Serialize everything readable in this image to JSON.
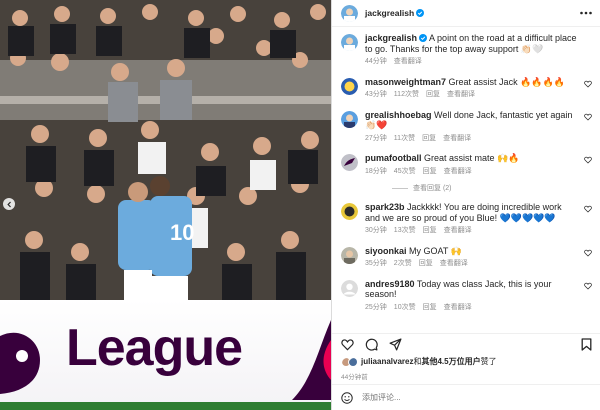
{
  "header": {
    "username": "jackgrealish"
  },
  "caption": {
    "username": "jackgrealish",
    "text": "A point on the road at a difficult place to go. Thanks for the top away support 👏🏻🤍",
    "time": "44分钟",
    "translate": "查看翻译"
  },
  "comments": [
    {
      "username": "masonweightman7",
      "text": "Great assist Jack 🔥🔥🔥🔥",
      "time": "43分钟",
      "likes": "112次赞",
      "reply": "回复",
      "translate": "查看翻译",
      "avatar_color": "#2a5db0"
    },
    {
      "username": "grealishhoebag",
      "text": "Well done Jack, fantastic yet again 👏🏻❤️",
      "time": "27分钟",
      "likes": "11次赞",
      "reply": "回复",
      "translate": "查看翻译",
      "avatar_color": "#5a9fe0"
    },
    {
      "username": "pumafootball",
      "text": "Great assist mate 🙌🔥",
      "time": "18分钟",
      "likes": "45次赞",
      "reply": "回复",
      "translate": "查看翻译",
      "avatar_color": "#c0c0c8",
      "view_replies": "查看回复 (2)"
    },
    {
      "username": "spark23b",
      "text": "Jackkkk! You are doing incredible work and we are so proud of you Blue! 💙💙💙💙💙",
      "time": "30分钟",
      "likes": "13次赞",
      "reply": "回复",
      "translate": "查看翻译",
      "avatar_color": "#e8c83a"
    },
    {
      "username": "siyoonkai",
      "text": "My GOAT 🙌",
      "time": "35分钟",
      "likes": "2次赞",
      "reply": "回复",
      "translate": "查看翻译",
      "avatar_color": "#b8b6a8"
    },
    {
      "username": "andres9180",
      "text": "Today was class Jack, this is your season!",
      "time": "25分钟",
      "likes": "10次赞",
      "reply": "回复",
      "translate": "查看翻译",
      "avatar_color": "#dcdcdc"
    }
  ],
  "likes": {
    "user": "juliaanalvarez",
    "joiner": "和",
    "others": "其他4.5万位用户",
    "suffix": "赞了"
  },
  "post_time": "44分钟前",
  "add_comment": {
    "placeholder": "添加评论..."
  },
  "board": {
    "text": "League"
  },
  "colors": {
    "accent_blue": "#0095f6",
    "text": "#262626",
    "muted": "#8e8e8e",
    "premier_purple": "#38003c",
    "city_blue": "#6cabdd"
  }
}
